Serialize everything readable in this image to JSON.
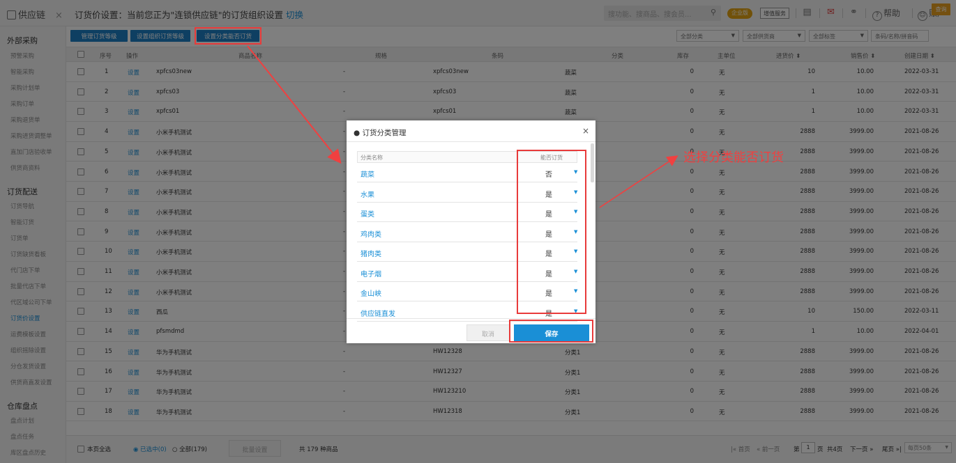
{
  "topbar": {
    "app_name": "供应链",
    "close": "×",
    "page_title": "订货价设置：当前您正为\"连锁供应链\"的订货组织设置",
    "switch_link": "切换",
    "search_placeholder": "搜功能、搜商品、搜会员...",
    "badge_edition": "企业版",
    "badge_vas": "增值服务",
    "help": "帮助",
    "account": "账户"
  },
  "sidebar": {
    "sections": [
      {
        "title": "外部采购",
        "items": [
          "预警采购",
          "智能采购",
          "采购计划单",
          "采购订单",
          "采购退货单",
          "采购进货调整单",
          "直加门店验收单",
          "供货商资料"
        ]
      },
      {
        "title": "订货配送",
        "items": [
          "订货导航",
          "智能订货",
          "订货单",
          "订货缺货看板",
          "代门店下单",
          "批量代店下单",
          "代区域公司下单",
          "订货价设置",
          "运费模板设置",
          "组织摇除设置",
          "分仓发货设置",
          "供货商直发设置"
        ]
      },
      {
        "title": "仓库盘点",
        "items": [
          "盘点计划",
          "盘点任务",
          "库区盘点历史"
        ]
      }
    ],
    "active_item": "订货价设置"
  },
  "toolbar": {
    "buttons": [
      "管理订货等级",
      "设置组织订货等级",
      "设置分类能否订货"
    ],
    "filters": [
      "全部分类",
      "全部供货商",
      "全部标签"
    ],
    "search_placeholder": "条码/名称/拼音码",
    "query_label": "查询"
  },
  "table": {
    "headers": [
      "序号",
      "操作",
      "商品名称",
      "规格",
      "条码",
      "分类",
      "库存",
      "主单位",
      "进货价 ⬍",
      "销售价 ⬍",
      "创建日期 ⬍"
    ],
    "rows": [
      {
        "no": "1",
        "op": "设置",
        "name": "xpfcs03new",
        "spec": "-",
        "code": "xpfcs03new",
        "cat": "蔬菜",
        "stock": "0",
        "unit": "无",
        "buy": "10",
        "sell": "10.00",
        "date": "2022-03-31"
      },
      {
        "no": "2",
        "op": "设置",
        "name": "xpfcs03",
        "spec": "-",
        "code": "xpfcs03",
        "cat": "蔬菜",
        "stock": "0",
        "unit": "无",
        "buy": "1",
        "sell": "10.00",
        "date": "2022-03-31"
      },
      {
        "no": "3",
        "op": "设置",
        "name": "xpfcs01",
        "spec": "-",
        "code": "xpfcs01",
        "cat": "蔬菜",
        "stock": "0",
        "unit": "无",
        "buy": "1",
        "sell": "10.00",
        "date": "2022-03-31"
      },
      {
        "no": "4",
        "op": "设置",
        "name": "小米手机测试",
        "spec": "-",
        "code": "",
        "cat": "",
        "stock": "0",
        "unit": "无",
        "buy": "2888",
        "sell": "3999.00",
        "date": "2021-08-26"
      },
      {
        "no": "5",
        "op": "设置",
        "name": "小米手机测试",
        "spec": "-",
        "code": "",
        "cat": "",
        "stock": "0",
        "unit": "无",
        "buy": "2888",
        "sell": "3999.00",
        "date": "2021-08-26"
      },
      {
        "no": "6",
        "op": "设置",
        "name": "小米手机测试",
        "spec": "-",
        "code": "",
        "cat": "",
        "stock": "0",
        "unit": "无",
        "buy": "2888",
        "sell": "3999.00",
        "date": "2021-08-26"
      },
      {
        "no": "7",
        "op": "设置",
        "name": "小米手机测试",
        "spec": "-",
        "code": "",
        "cat": "",
        "stock": "0",
        "unit": "无",
        "buy": "2888",
        "sell": "3999.00",
        "date": "2021-08-26"
      },
      {
        "no": "8",
        "op": "设置",
        "name": "小米手机测试",
        "spec": "-",
        "code": "",
        "cat": "",
        "stock": "0",
        "unit": "无",
        "buy": "2888",
        "sell": "3999.00",
        "date": "2021-08-26"
      },
      {
        "no": "9",
        "op": "设置",
        "name": "小米手机测试",
        "spec": "-",
        "code": "",
        "cat": "",
        "stock": "0",
        "unit": "无",
        "buy": "2888",
        "sell": "3999.00",
        "date": "2021-08-26"
      },
      {
        "no": "10",
        "op": "设置",
        "name": "小米手机测试",
        "spec": "-",
        "code": "",
        "cat": "",
        "stock": "0",
        "unit": "无",
        "buy": "2888",
        "sell": "3999.00",
        "date": "2021-08-26"
      },
      {
        "no": "11",
        "op": "设置",
        "name": "小米手机测试",
        "spec": "-",
        "code": "",
        "cat": "",
        "stock": "0",
        "unit": "无",
        "buy": "2888",
        "sell": "3999.00",
        "date": "2021-08-26"
      },
      {
        "no": "12",
        "op": "设置",
        "name": "小米手机测试",
        "spec": "-",
        "code": "",
        "cat": "",
        "stock": "0",
        "unit": "无",
        "buy": "2888",
        "sell": "3999.00",
        "date": "2021-08-26"
      },
      {
        "no": "13",
        "op": "设置",
        "name": "西瓜",
        "spec": "-",
        "code": "",
        "cat": "",
        "stock": "0",
        "unit": "无",
        "buy": "10",
        "sell": "150.00",
        "date": "2022-03-11"
      },
      {
        "no": "14",
        "op": "设置",
        "name": "pfsmdmd",
        "spec": "-",
        "code": "",
        "cat": "",
        "stock": "0",
        "unit": "无",
        "buy": "1",
        "sell": "10.00",
        "date": "2022-04-01"
      },
      {
        "no": "15",
        "op": "设置",
        "name": "华为手机测试",
        "spec": "-",
        "code": "HW12328",
        "cat": "分类1",
        "stock": "0",
        "unit": "无",
        "buy": "2888",
        "sell": "3999.00",
        "date": "2021-08-26"
      },
      {
        "no": "16",
        "op": "设置",
        "name": "华为手机测试",
        "spec": "-",
        "code": "HW12327",
        "cat": "分类1",
        "stock": "0",
        "unit": "无",
        "buy": "2888",
        "sell": "3999.00",
        "date": "2021-08-26"
      },
      {
        "no": "17",
        "op": "设置",
        "name": "华为手机测试",
        "spec": "-",
        "code": "HW123210",
        "cat": "分类1",
        "stock": "0",
        "unit": "无",
        "buy": "2888",
        "sell": "3999.00",
        "date": "2021-08-26"
      },
      {
        "no": "18",
        "op": "设置",
        "name": "华为手机测试",
        "spec": "-",
        "code": "HW12318",
        "cat": "分类1",
        "stock": "0",
        "unit": "无",
        "buy": "2888",
        "sell": "3999.00",
        "date": "2021-08-26"
      }
    ]
  },
  "footer": {
    "select_page": "本页全选",
    "selected": "已选中(0)",
    "all": "全部(179)",
    "batch": "批量设置",
    "total": "共 179 种商品",
    "first": "首页",
    "prev": "前一页",
    "page_pre": "第",
    "page_value": "1",
    "page_post": "页",
    "total_pages": "共4页",
    "next": "下一页",
    "last": "尾页",
    "per_page": "每页50条"
  },
  "modal": {
    "title": "订货分类管理",
    "close": "×",
    "col_name": "分类名称",
    "col_order": "能否订货",
    "categories": [
      {
        "name": "蔬菜",
        "value": "否"
      },
      {
        "name": "水果",
        "value": "是"
      },
      {
        "name": "蛋类",
        "value": "是"
      },
      {
        "name": "鸡肉类",
        "value": "是"
      },
      {
        "name": "猪肉类",
        "value": "是"
      },
      {
        "name": "电子烟",
        "value": "是"
      },
      {
        "name": "金山峡",
        "value": "是"
      },
      {
        "name": "供应链直发",
        "value": "是"
      }
    ],
    "cancel": "取消",
    "save": "保存"
  },
  "annotation": {
    "text": "选择分类能否订货",
    "color": "#f04040"
  },
  "colors": {
    "accent": "#1a8fd6",
    "toolbar_btn": "#1d7fc4",
    "query": "#e8a020",
    "highlight": "#e83a3a"
  }
}
